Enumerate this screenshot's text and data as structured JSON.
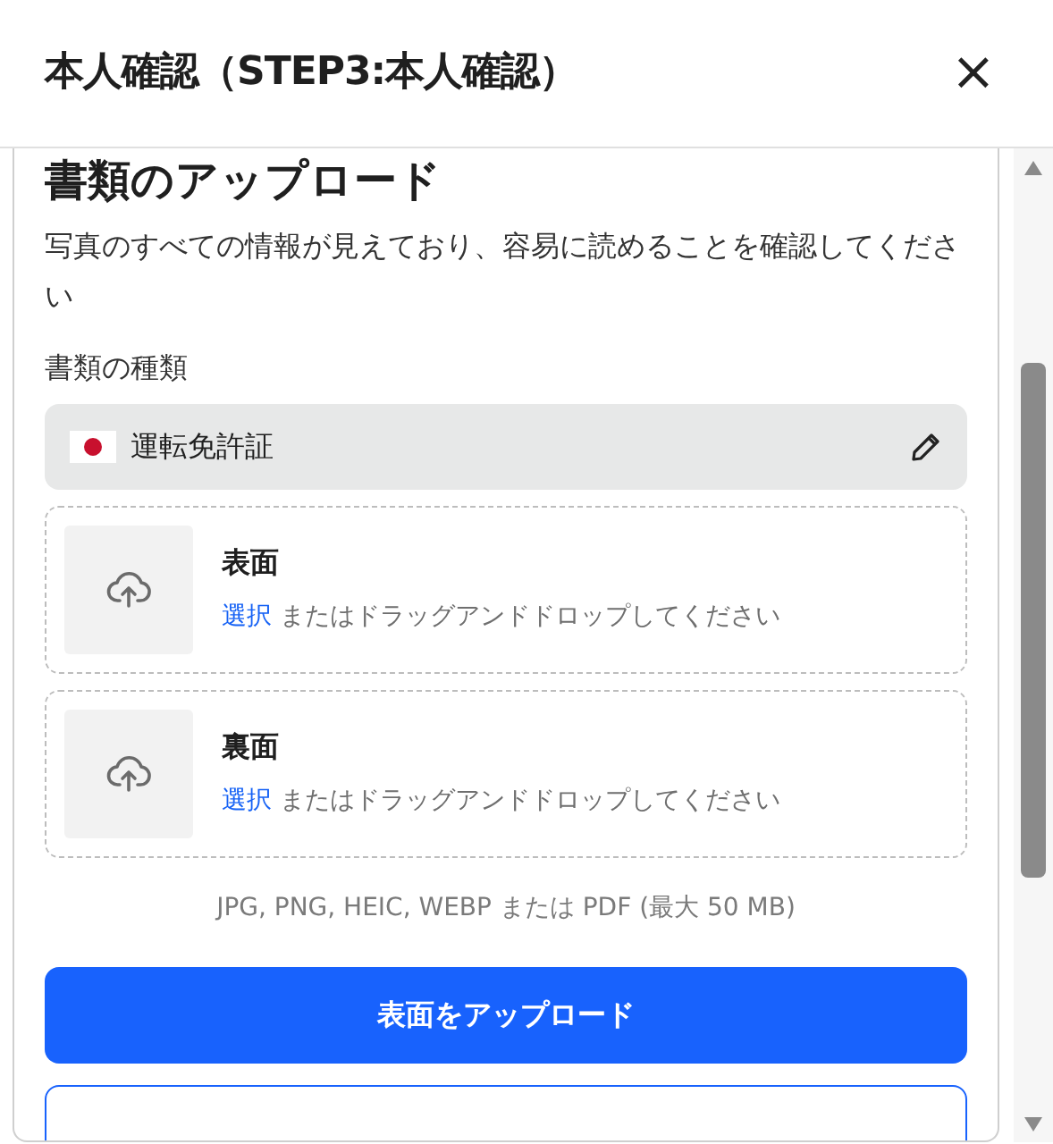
{
  "dialog": {
    "title": "本人確認（STEP3:本人確認）",
    "close": "×"
  },
  "section": {
    "heading": "書類のアップロード",
    "description": "写真のすべての情報が見えており、容易に読めることを確認してください"
  },
  "document_type": {
    "label": "書類の種類",
    "value": "運転免許証"
  },
  "upload_slots": [
    {
      "title": "表面",
      "link": "選択",
      "hint": "またはドラッグアンドドロップしてください"
    },
    {
      "title": "裏面",
      "link": "選択",
      "hint": "またはドラッグアンドドロップしてください"
    }
  ],
  "formats": "JPG, PNG, HEIC, WEBP または PDF (最大 50 MB)",
  "buttons": [
    {
      "label": "表面をアップロード",
      "kind": "primary"
    },
    {
      "kind": "outline"
    }
  ]
}
